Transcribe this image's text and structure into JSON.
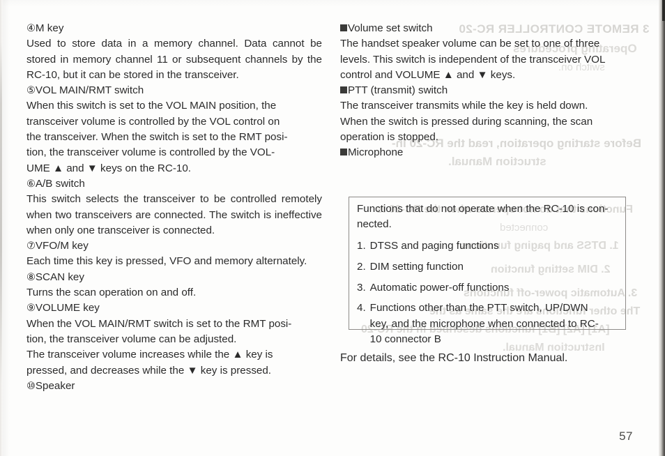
{
  "document": {
    "page_number": "57",
    "colors": {
      "paper": "#fdfdfc",
      "ink": "#2b2b2b",
      "bleed_through": "#d9d8d5",
      "box_border": "#8d8b88",
      "bullet": "#3a3a38"
    }
  },
  "left_column": {
    "sections": [
      {
        "marker": "④",
        "heading": "M  key",
        "body": "Used to store data in a memory channel. Data cannot be stored in memory channel 11 or subsequent channels by the RC-10, but it can be stored in the transceiver."
      },
      {
        "marker": "⑤",
        "heading": "VOL MAIN/RMT switch",
        "body_lines": [
          "When this switch is set to the VOL MAIN position, the",
          "transceiver volume is controlled by the VOL control on",
          "the transceiver. When the switch is set to the RMT posi-",
          "tion, the transceiver volume is controlled by the VOL-",
          "UME ▲ and ▼ keys on the RC-10."
        ]
      },
      {
        "marker": "⑥",
        "heading": "A/B switch",
        "body": "This switch selects the transceiver to be controlled remotely when two transceivers are connected. The switch is ineffective when only one transceiver is connected."
      },
      {
        "marker": "⑦",
        "heading": "VFO/M key",
        "body": "Each time this key is pressed, VFO and memory alternately."
      },
      {
        "marker": "⑧",
        "heading": "SCAN key",
        "body": "Turns the scan operation on and off."
      },
      {
        "marker": "⑨",
        "heading": "VOLUME key",
        "body_lines": [
          "When the VOL MAIN/RMT switch is set to the RMT posi-",
          "tion, the transceiver volume can be adjusted.",
          "The transceiver volume increases while the ▲ key is",
          "pressed, and decreases while the ▼ key is pressed."
        ]
      },
      {
        "marker": "⑩",
        "heading": "Speaker",
        "body": ""
      }
    ]
  },
  "right_column": {
    "sections": [
      {
        "bullet": "filled-square",
        "heading": "Volume set switch",
        "body_lines": [
          "The handset speaker volume can be set to one of three",
          "levels. This switch is independent of the transceiver VOL",
          "control and VOLUME ▲ and ▼ keys."
        ]
      },
      {
        "bullet": "filled-square",
        "heading": "PTT (transmit) switch",
        "body_lines": [
          "The transceiver transmits while the key is held down.",
          "When the switch is pressed during scanning, the scan",
          "operation is stopped."
        ]
      },
      {
        "bullet": "filled-square",
        "heading": "Microphone",
        "body_lines": []
      }
    ],
    "callout_box": {
      "lead_lines": [
        "Functions that do not operate when the RC-10 is con-",
        "nected."
      ],
      "items": [
        {
          "number": "1.",
          "text_lines": [
            "DTSS and paging functions"
          ]
        },
        {
          "number": "2.",
          "text_lines": [
            "DIM setting function"
          ]
        },
        {
          "number": "3.",
          "text_lines": [
            "Automatic power-off functions"
          ]
        },
        {
          "number": "4.",
          "text_lines": [
            "Functions other than the PTT switch, UP/DWN",
            "key, and the microphone when connected to RC-",
            "10 connector B"
          ]
        }
      ]
    },
    "closing_note": "For details, see the RC-10 Instruction Manual."
  },
  "bleed_through": {
    "lines": [
      "3 REMOTE CONTROLLER   RC-20",
      "Operating procedures",
      "switch on.",
      "Before starting operation, read the RC-20 In-",
      "struction Manual.",
      "Functions that do not operate when the RC-20 is",
      "connected",
      "1.  DTSS and paging functions",
      "2.  DIM setting function",
      "3.  Automatic power-off functions",
      "The other functions are the same as the",
      "[A1] [A2] [B1] functions described in the RC-20",
      "Instruction Manual."
    ]
  }
}
